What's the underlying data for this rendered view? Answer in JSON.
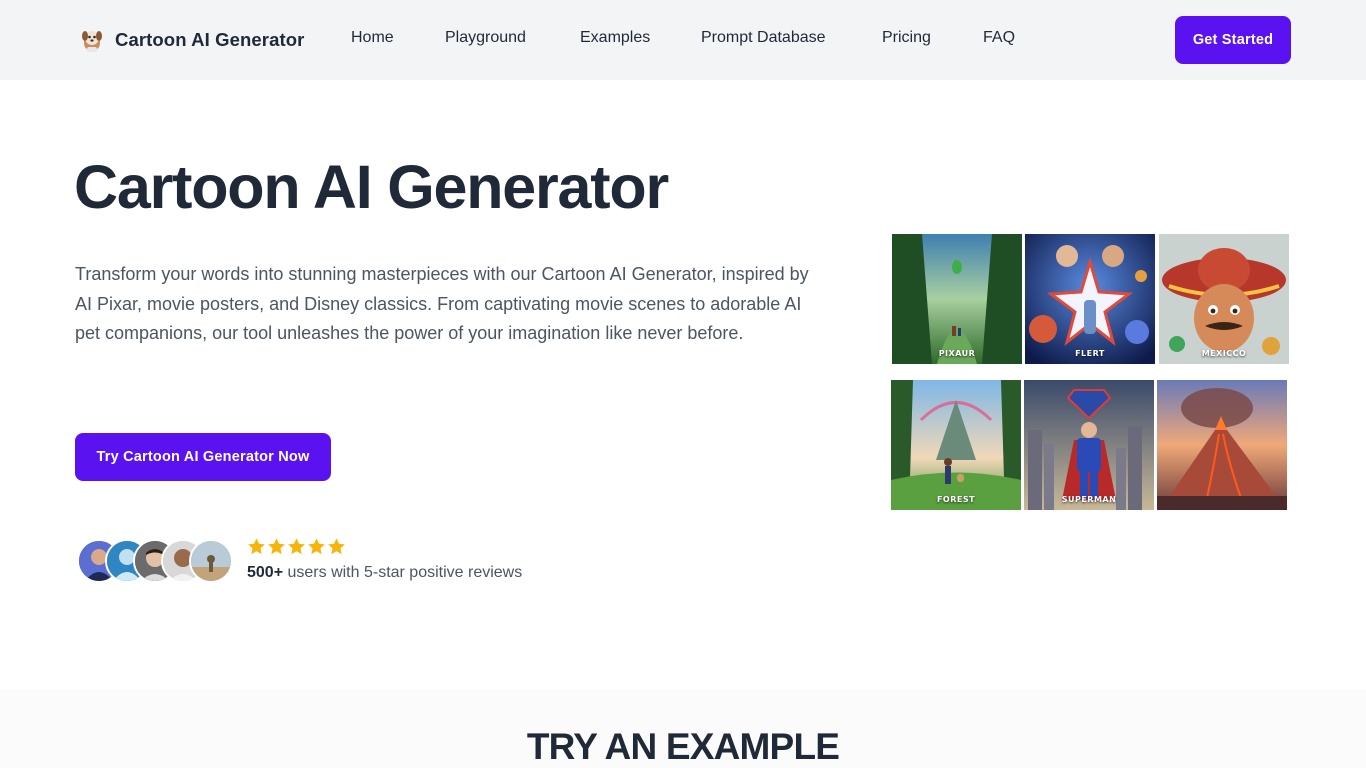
{
  "brand": {
    "name": "Cartoon AI Generator",
    "logo_icon": "puppy-icon"
  },
  "nav": {
    "items": [
      {
        "label": "Home"
      },
      {
        "label": "Playground"
      },
      {
        "label": "Examples"
      },
      {
        "label": "Prompt Database"
      },
      {
        "label": "Pricing"
      },
      {
        "label": "FAQ"
      }
    ],
    "cta_label": "Get Started"
  },
  "hero": {
    "title": "Cartoon AI Generator",
    "description": "Transform your words into stunning masterpieces with our Cartoon AI Generator, inspired by AI Pixar, movie posters, and Disney classics. From captivating movie scenes to adorable AI pet companions, our tool unleashes the power of your imagination like never before.",
    "cta_label": "Try Cartoon AI Generator Now"
  },
  "social_proof": {
    "rating_stars": 5,
    "count": "500+",
    "text": " users with 5-star positive reviews"
  },
  "gallery": {
    "tiles": [
      {
        "caption": "PIXAUR"
      },
      {
        "caption": "FLERT"
      },
      {
        "caption": "MEXICCO"
      },
      {
        "caption": "FOREST"
      },
      {
        "caption": "SUPERMAN"
      },
      {
        "caption": ""
      }
    ]
  },
  "section": {
    "title": "TRY AN EXAMPLE"
  },
  "colors": {
    "accent": "#5b12f0",
    "header_bg": "#f3f4f6",
    "star": "#f5b50a",
    "text_dark": "#1f2937",
    "text_muted": "#4b5563"
  }
}
